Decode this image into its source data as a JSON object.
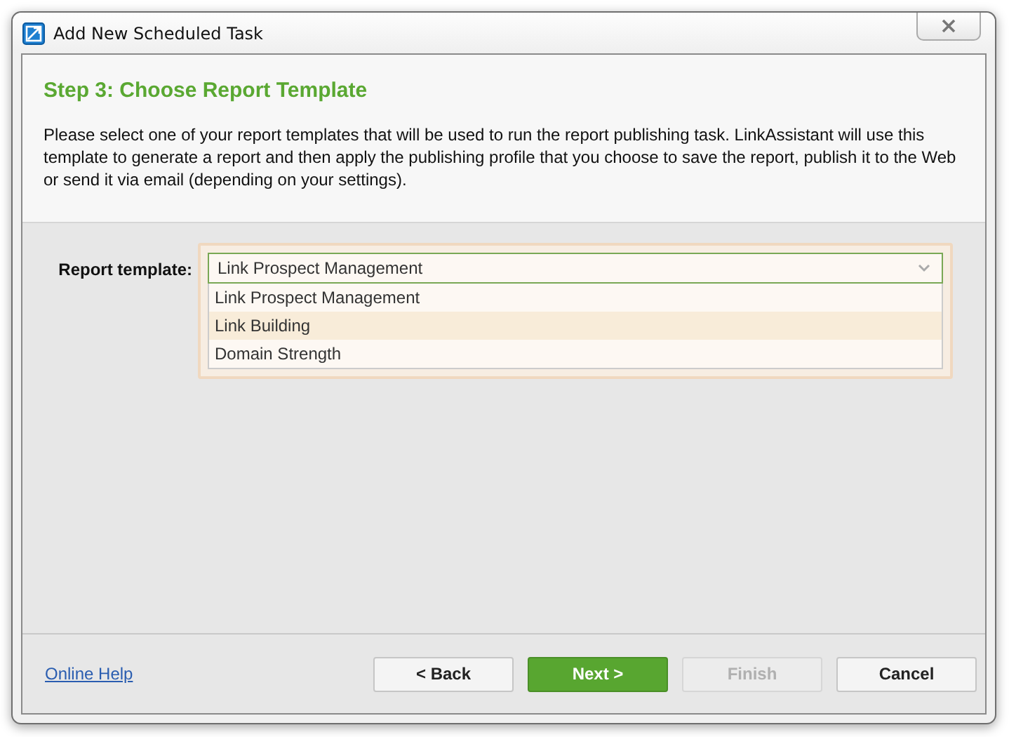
{
  "window": {
    "title": "Add New Scheduled Task"
  },
  "header": {
    "title": "Step 3: Choose Report Template",
    "description": "Please select one of your report templates that will be used to run the report publishing task. LinkAssistant will use this template to generate a report and then apply the publishing profile that you choose to save the report, publish it to the Web or send it via email (depending on your settings)."
  },
  "form": {
    "label": "Report template:",
    "value": "Link Prospect Management",
    "expanded": true,
    "options": [
      {
        "label": "Link Prospect Management",
        "highlighted": false
      },
      {
        "label": "Link Building",
        "highlighted": true
      },
      {
        "label": "Domain Strength",
        "highlighted": false
      }
    ]
  },
  "footer": {
    "help_link": "Online Help",
    "buttons": [
      {
        "label": "< Back",
        "kind": "normal",
        "disabled": false
      },
      {
        "label": "Next >",
        "kind": "primary",
        "disabled": false
      },
      {
        "label": "Finish",
        "kind": "normal",
        "disabled": true
      },
      {
        "label": "Cancel",
        "kind": "normal",
        "disabled": false
      }
    ]
  }
}
